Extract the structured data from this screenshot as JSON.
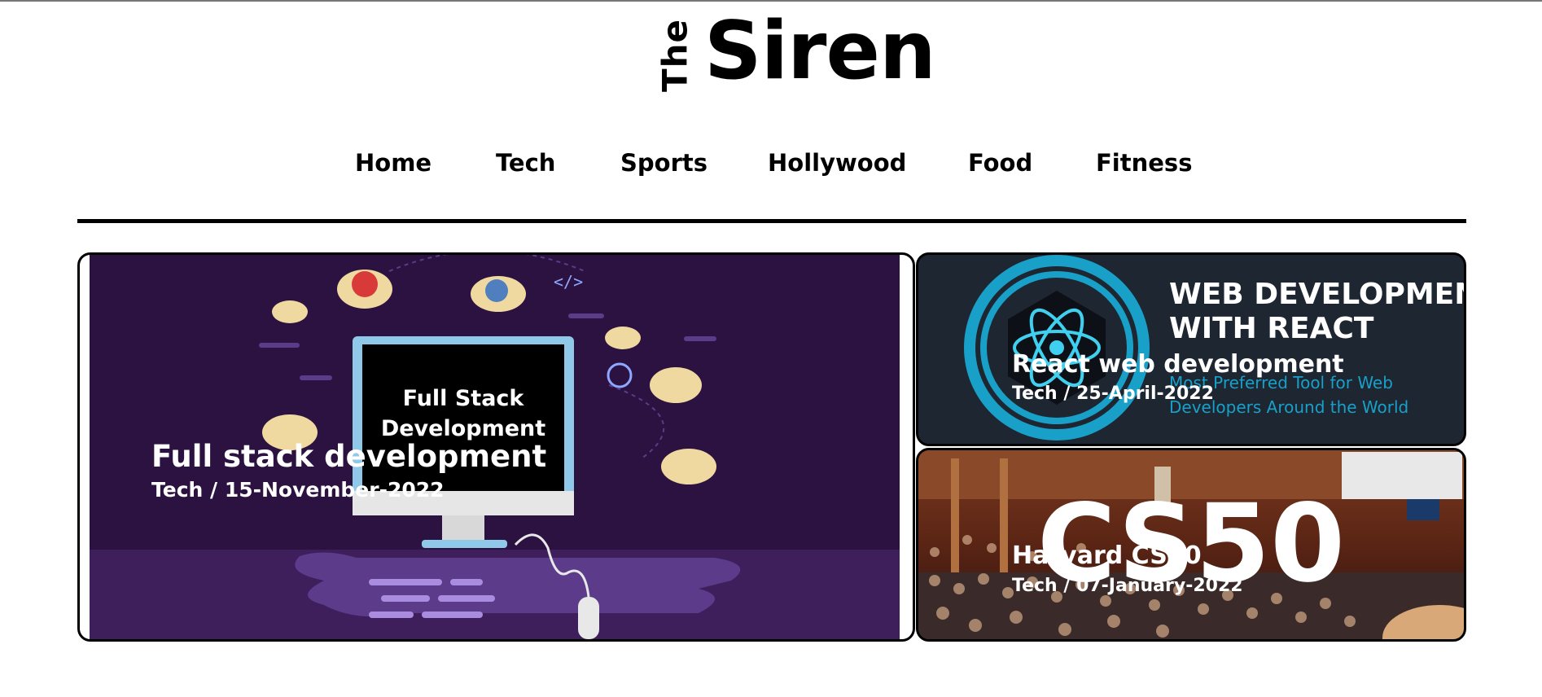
{
  "site": {
    "logo_small": "The",
    "logo_main": "Siren"
  },
  "nav": {
    "items": [
      {
        "label": "Home"
      },
      {
        "label": "Tech"
      },
      {
        "label": "Sports"
      },
      {
        "label": "Hollywood"
      },
      {
        "label": "Food"
      },
      {
        "label": "Fitness"
      }
    ]
  },
  "featured": {
    "main": {
      "title": "Full stack development",
      "meta": "Tech / 15-November-2022",
      "image_text_line1": "Full Stack",
      "image_text_line2": "Development"
    },
    "side": [
      {
        "title": "React web development",
        "meta": "Tech / 25-April-2022",
        "image_heading_line1": "WEB DEVELOPMENT",
        "image_heading_line2": "WITH REACT",
        "image_sub_line1": "Most Preferred Tool for Web",
        "image_sub_line2": "Developers Around the World"
      },
      {
        "title": "Harvard CS50",
        "meta": "Tech / 07-January-2022",
        "image_text": "CS50"
      }
    ]
  },
  "colors": {
    "accent": "#000000",
    "card_text": "#ffffff",
    "react_cyan": "#18a0c8",
    "fullstack_purple": "#2c1240"
  }
}
